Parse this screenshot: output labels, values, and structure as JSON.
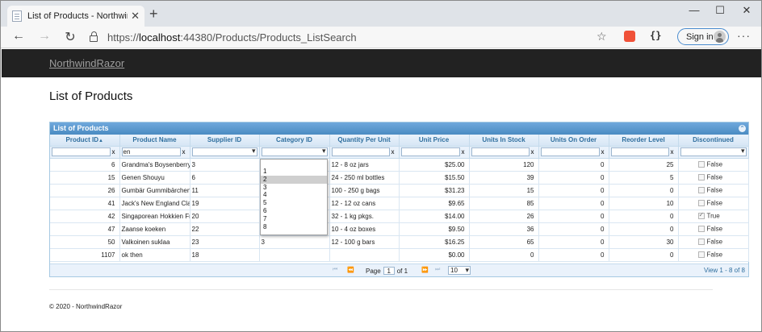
{
  "browser": {
    "tab_title": "List of Products - NorthwindRazor",
    "url_prefix": "https://",
    "url_host": "localhost",
    "url_rest": ":44380/Products/Products_ListSearch",
    "signin_label": "Sign in"
  },
  "site": {
    "brand": "NorthwindRazor",
    "page_title": "List of Products",
    "footer": "© 2020 - NorthwindRazor"
  },
  "grid": {
    "caption": "List of Products",
    "columns": [
      "Product ID",
      "Product Name",
      "Supplier ID",
      "Category ID",
      "Quantity Per Unit",
      "Unit Price",
      "Units In Stock",
      "Units On Order",
      "Reorder Level",
      "Discontinued"
    ],
    "sort_indicator": "▲",
    "clear_glyph": "x",
    "filter_product_name": "en",
    "rows": [
      {
        "id": "6",
        "name": "Grandma's Boysenberry Spread",
        "supplier": "3",
        "category": "",
        "qty": "12 - 8 oz jars",
        "price": "$25.00",
        "stock": "120",
        "order": "0",
        "reorder": "25",
        "disc_label": "False",
        "disc_checked": false
      },
      {
        "id": "15",
        "name": "Genen Shouyu",
        "supplier": "6",
        "category": "",
        "qty": "24 - 250 ml bottles",
        "price": "$15.50",
        "stock": "39",
        "order": "0",
        "reorder": "5",
        "disc_label": "False",
        "disc_checked": false
      },
      {
        "id": "26",
        "name": "Gumbär Gummibärchen",
        "supplier": "11",
        "category": "",
        "qty": "100 - 250 g bags",
        "price": "$31.23",
        "stock": "15",
        "order": "0",
        "reorder": "0",
        "disc_label": "False",
        "disc_checked": false
      },
      {
        "id": "41",
        "name": "Jack's New England Clam Chowder",
        "supplier": "19",
        "category": "",
        "qty": "12 - 12 oz cans",
        "price": "$9.65",
        "stock": "85",
        "order": "0",
        "reorder": "10",
        "disc_label": "False",
        "disc_checked": false
      },
      {
        "id": "42",
        "name": "Singaporean Hokkien Fried Mee",
        "supplier": "20",
        "category": "",
        "qty": "32 - 1 kg pkgs.",
        "price": "$14.00",
        "stock": "26",
        "order": "0",
        "reorder": "0",
        "disc_label": "True",
        "disc_checked": true
      },
      {
        "id": "47",
        "name": "Zaanse koeken",
        "supplier": "22",
        "category": "",
        "qty": "10 - 4 oz boxes",
        "price": "$9.50",
        "stock": "36",
        "order": "0",
        "reorder": "0",
        "disc_label": "False",
        "disc_checked": false
      },
      {
        "id": "50",
        "name": "Valkoinen suklaa",
        "supplier": "23",
        "category": "3",
        "qty": "12 - 100 g bars",
        "price": "$16.25",
        "stock": "65",
        "order": "0",
        "reorder": "30",
        "disc_label": "False",
        "disc_checked": false
      },
      {
        "id": "1107",
        "name": "ok then",
        "supplier": "18",
        "category": "",
        "qty": "",
        "price": "$0.00",
        "stock": "0",
        "order": "0",
        "reorder": "0",
        "disc_label": "False",
        "disc_checked": false
      }
    ],
    "category_options": [
      "",
      "1",
      "2",
      "3",
      "4",
      "5",
      "6",
      "7",
      "8"
    ],
    "category_selected_index": 2,
    "pager": {
      "page_label": "Page",
      "page_value": "1",
      "of_label": "of 1",
      "rows_value": "10",
      "view_text": "View 1 - 8 of 8"
    }
  }
}
